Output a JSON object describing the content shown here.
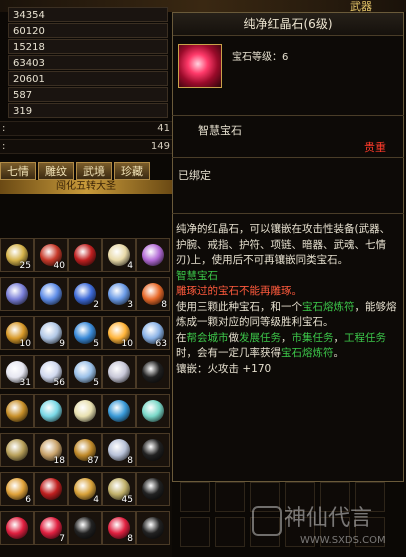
{
  "top_corner": "武器",
  "stats": [
    "34354",
    "60120",
    "15218",
    "63403",
    "20601",
    "587",
    "319"
  ],
  "bars": [
    {
      "prefix": ":",
      "value": "41"
    },
    {
      "prefix": ":",
      "value": "149"
    }
  ],
  "tabs": [
    "七情",
    "雕纹",
    "武境",
    "珍藏"
  ],
  "banner_text": "闯化五转大圣",
  "inventory": {
    "rows": [
      [
        {
          "num": "25",
          "color": "#d4b24a"
        },
        {
          "num": "40",
          "color": "#c83a2a"
        },
        {
          "num": "",
          "color": "#c02020"
        },
        {
          "num": "4",
          "color": "#e8d9a8"
        },
        {
          "num": "",
          "color": "#b36bd6"
        }
      ],
      [
        {
          "num": "",
          "color": "#7a7fd8"
        },
        {
          "num": "",
          "color": "#5f8de8"
        },
        {
          "num": "2",
          "color": "#3e6bd8"
        },
        {
          "num": "3",
          "color": "#6a9ae6"
        },
        {
          "num": "8",
          "color": "#e86a2a"
        }
      ],
      [
        {
          "num": "10",
          "color": "#d89a2a"
        },
        {
          "num": "9",
          "color": "#b2c8e6"
        },
        {
          "num": "5",
          "color": "#3a8ad8"
        },
        {
          "num": "10",
          "color": "#ffb43a"
        },
        {
          "num": "63",
          "color": "#8ab2e6"
        }
      ],
      [
        {
          "num": "31",
          "color": "#e6e6f0"
        },
        {
          "num": "56",
          "color": "#d0d8ee"
        },
        {
          "num": "5",
          "color": "#9ac0e8"
        },
        {
          "num": "",
          "color": "#c8c8d8"
        },
        {
          "num": "",
          "color": "#222"
        }
      ],
      [
        {
          "num": "",
          "color": "#c8902a"
        },
        {
          "num": "",
          "color": "#7ad8e6"
        },
        {
          "num": "",
          "color": "#e8e0b0"
        },
        {
          "num": "",
          "color": "#3a9ad8"
        },
        {
          "num": "",
          "color": "#7ad8c8"
        }
      ],
      [
        {
          "num": "",
          "color": "#b8a05a"
        },
        {
          "num": "18",
          "color": "#c8a26a"
        },
        {
          "num": "87",
          "color": "#c08a2a"
        },
        {
          "num": "8",
          "color": "#b8c2d8"
        },
        {
          "num": "",
          "color": "#222"
        }
      ],
      [
        {
          "num": "6",
          "color": "#e0a23a"
        },
        {
          "num": "",
          "color": "#c02020"
        },
        {
          "num": "4",
          "color": "#d8a23a"
        },
        {
          "num": "45",
          "color": "#c0b06a"
        },
        {
          "num": "",
          "color": "#222"
        }
      ],
      [
        {
          "num": "",
          "color": "#e02040"
        },
        {
          "num": "7",
          "color": "#e02040"
        },
        {
          "num": "",
          "color": "#222"
        },
        {
          "num": "8",
          "color": "#e02040"
        },
        {
          "num": "",
          "color": "#222"
        }
      ]
    ]
  },
  "tooltip": {
    "title": "纯净红晶石(6级)",
    "gem_level": "宝石等级：6",
    "category": "智慧宝石",
    "price_label": "贵重",
    "bound": "已绑定",
    "desc": {
      "p1": "纯净的红晶石，可以镶嵌在攻击性装备(武器、护腕、戒指、护符、项链、暗器、武魂、七情刃)上，使用后不可再镶嵌同类宝石。",
      "p2": "智慧宝石",
      "p3": "雕琢过的宝石不能再雕琢。",
      "p4_a": "使用三颗此种宝石，和一个",
      "p4_b": "宝石熔炼符",
      "p4_c": "，能够熔炼成一颗对应的同等级胜利宝石。",
      "p5_a": "在",
      "p5_b": "帮会城市",
      "p5_c": "做",
      "p5_d": "发展任务",
      "p5_e": "，",
      "p5_f": "市集任务",
      "p5_g": "，",
      "p5_h": "工程任务",
      "p5_i": "时，会有一定几率获得",
      "p5_j": "宝石熔炼符",
      "p5_k": "。",
      "p6": "镶嵌：火攻击 +170"
    }
  },
  "watermark": {
    "brand": "神仙代言",
    "url": "WWW.SXDS.COM"
  },
  "colors": {
    "green": "#3cc84a",
    "red": "#ff5a3c",
    "gold": "#c8a24a"
  }
}
